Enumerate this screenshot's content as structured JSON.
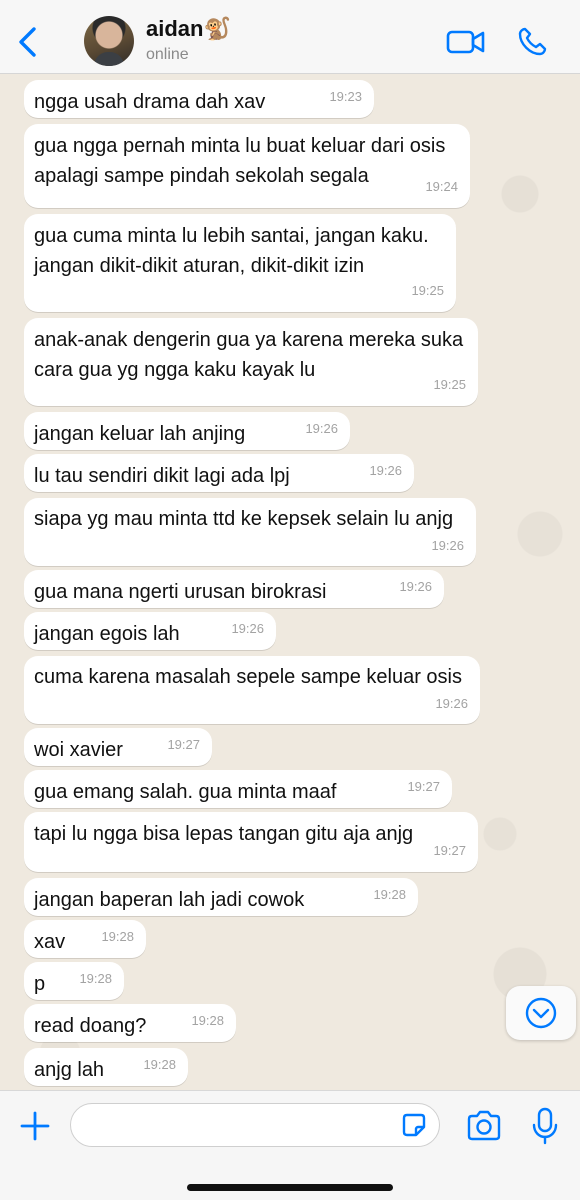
{
  "header": {
    "name": "aidan🐒",
    "status": "online",
    "accent": "#007aff"
  },
  "messages": [
    {
      "text": "ngga usah drama dah xav",
      "time": "19:23"
    },
    {
      "text": "gua ngga pernah minta lu buat keluar dari osis apalagi sampe pindah sekolah segala",
      "time": "19:24"
    },
    {
      "text": "gua cuma minta lu lebih santai, jangan kaku. jangan dikit-dikit aturan, dikit-dikit izin",
      "time": "19:25"
    },
    {
      "text": "anak-anak dengerin gua ya karena mereka suka cara gua yg ngga kaku kayak lu",
      "time": "19:25"
    },
    {
      "text": "jangan keluar lah anjing",
      "time": "19:26"
    },
    {
      "text": "lu tau sendiri dikit lagi ada lpj",
      "time": "19:26"
    },
    {
      "text": "siapa yg mau minta ttd ke kepsek selain lu anjg",
      "time": "19:26"
    },
    {
      "text": "gua mana ngerti urusan birokrasi",
      "time": "19:26"
    },
    {
      "text": "jangan egois lah",
      "time": "19:26"
    },
    {
      "text": "cuma karena masalah sepele sampe keluar osis",
      "time": "19:26"
    },
    {
      "text": "woi xavier",
      "time": "19:27"
    },
    {
      "text": "gua emang salah. gua minta maaf",
      "time": "19:27"
    },
    {
      "text": "tapi lu ngga bisa lepas tangan gitu aja anjg",
      "time": "19:27"
    },
    {
      "text": "jangan baperan lah jadi cowok",
      "time": "19:28"
    },
    {
      "text": "xav",
      "time": "19:28"
    },
    {
      "text": "p",
      "time": "19:28"
    },
    {
      "text": "read doang?",
      "time": "19:28"
    },
    {
      "text": "anjg lah",
      "time": "19:28"
    }
  ],
  "composer": {
    "value": "",
    "placeholder": ""
  },
  "icons": {
    "back": "chevron-left-icon",
    "video": "video-camera-icon",
    "call": "phone-icon",
    "scroll": "chevron-down-circle-icon",
    "plus": "plus-icon",
    "sticker": "sticker-icon",
    "camera": "camera-icon",
    "mic": "microphone-icon"
  }
}
